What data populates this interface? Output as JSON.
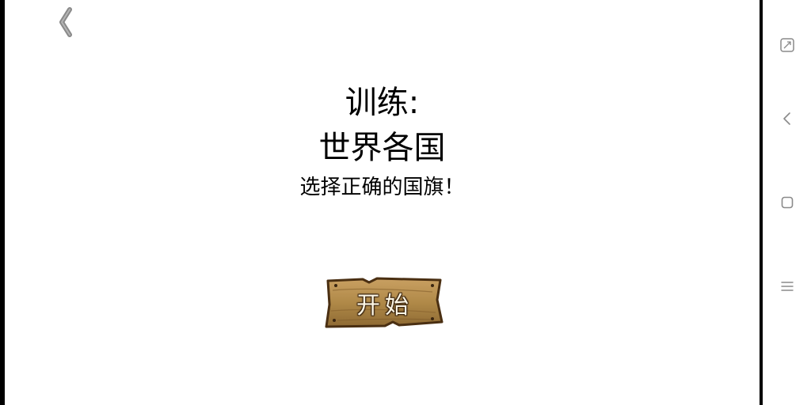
{
  "training": {
    "title_line1": "训练:",
    "title_line2": "世界各国",
    "subtitle": "选择正确的国旗！"
  },
  "start_button": {
    "label": "开始"
  },
  "icons": {
    "back": "chevron-left-icon",
    "fullscreen": "fullscreen-icon",
    "nav_back": "nav-back-icon",
    "nav_home": "nav-home-icon",
    "nav_menu": "nav-menu-icon"
  },
  "colors": {
    "background": "#ffffff",
    "text": "#000000",
    "wood": "#b08948",
    "wood_dark": "#5a3a1a",
    "icon_gray": "#8a8a8a"
  }
}
